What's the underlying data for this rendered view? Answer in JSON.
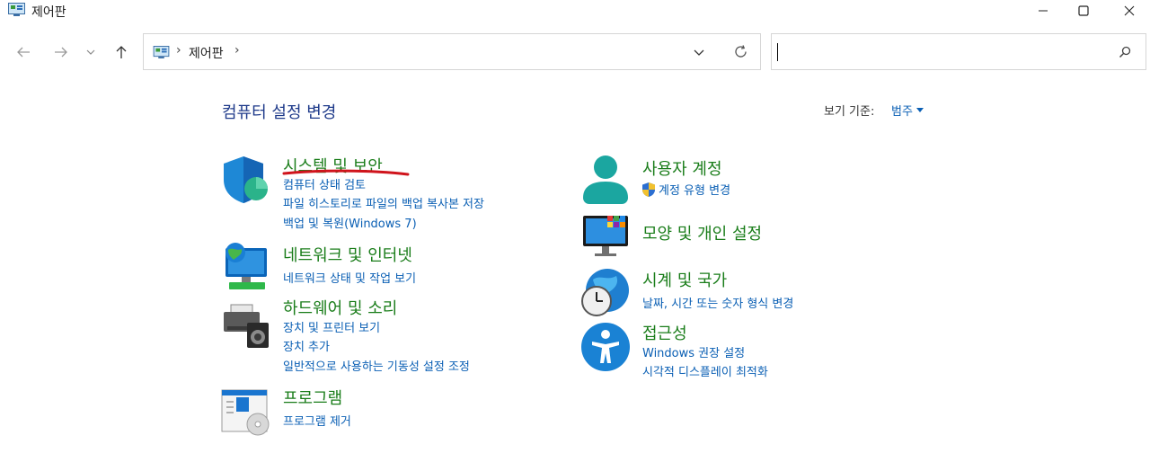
{
  "window": {
    "title": "제어판",
    "icon": "control-panel-icon"
  },
  "address": {
    "crumb": "제어판",
    "sep1": "›",
    "sep2": "›"
  },
  "search": {
    "placeholder": ""
  },
  "content": {
    "heading": "컴퓨터 설정 변경",
    "view_by_label": "보기 기준:",
    "view_by_value": "범주"
  },
  "categories": {
    "system": {
      "title": "시스템 및 보안",
      "links": [
        "컴퓨터 상태 검토",
        "파일 히스토리로 파일의 백업 복사본 저장",
        "백업 및 복원(Windows 7)"
      ],
      "icon": "shield-icon"
    },
    "network": {
      "title": "네트워크 및 인터넷",
      "links": [
        "네트워크 상태 및 작업 보기"
      ],
      "icon": "network-globe-icon"
    },
    "hardware": {
      "title": "하드웨어 및 소리",
      "links": [
        "장치 및 프린터 보기",
        "장치 추가",
        "일반적으로 사용하는 기동성 설정 조정"
      ],
      "icon": "printer-speaker-icon"
    },
    "programs": {
      "title": "프로그램",
      "links": [
        "프로그램 제거"
      ],
      "icon": "programs-disc-icon"
    },
    "user": {
      "title": "사용자 계정",
      "links": [
        "계정 유형 변경"
      ],
      "icon": "user-icon"
    },
    "appearance": {
      "title": "모양 및 개인 설정",
      "links": [],
      "icon": "monitor-palette-icon"
    },
    "clock": {
      "title": "시계 및 국가",
      "links": [
        "날짜, 시간 또는 숫자 형식 변경"
      ],
      "icon": "clock-globe-icon"
    },
    "access": {
      "title": "접근성",
      "links": [
        "Windows 권장 설정",
        "시각적 디스플레이 최적화"
      ],
      "icon": "accessibility-icon"
    }
  },
  "colors": {
    "category_title": "#1a7d1a",
    "link": "#0a5fb4",
    "heading": "#1e3a8a",
    "annotation_underline": "#d0141c"
  }
}
